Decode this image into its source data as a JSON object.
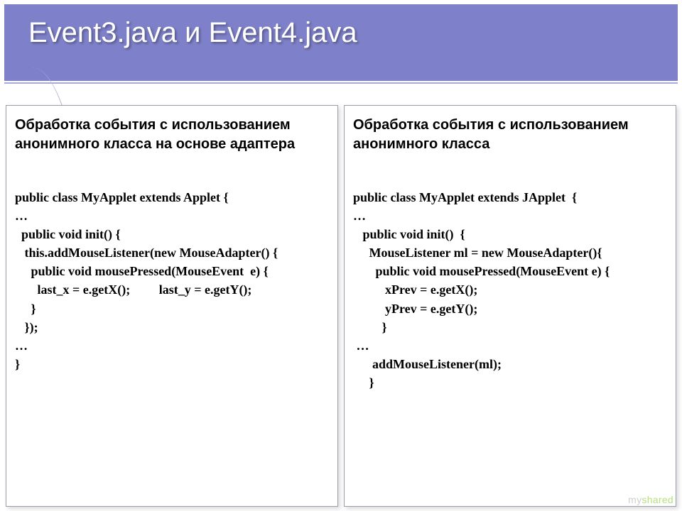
{
  "title": "Event3.java и Event4.java",
  "left": {
    "desc": "Обработка события с использованием анонимного класса на основе адаптера",
    "code": "public class MyApplet extends Applet {\n…\n  public void init() {\n   this.addMouseListener(new MouseAdapter() {\n     public void mousePressed(MouseEvent  e) {\n       last_x = e.getX();         last_y = e.getY();\n     }\n   });\n…\n}"
  },
  "right": {
    "desc": "Обработка события с использованием анонимного класса",
    "code": "public class MyApplet extends JApplet  {\n…\n   public void init()  {\n     MouseListener ml = new MouseAdapter(){\n       public void mousePressed(MouseEvent e) {\n          xPrev = e.getX();\n          yPrev = e.getY();\n         }\n …\n      addMouseListener(ml);\n     }"
  },
  "watermark": {
    "my": "my",
    "shared": "shared"
  }
}
